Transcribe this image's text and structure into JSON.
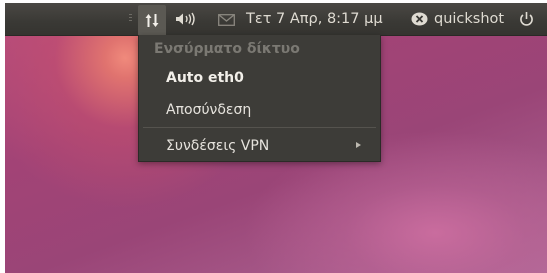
{
  "panel": {
    "clock": "Τετ  7 Απρ,  8:17 μμ",
    "username": "quickshot"
  },
  "network_menu": {
    "header": "Ενσύρματο δίκτυο",
    "items": [
      {
        "label": "Auto eth0",
        "bold": true
      },
      {
        "label": "Αποσύνδεση"
      },
      {
        "label": "Συνδέσεις VPN",
        "submenu": true
      }
    ]
  },
  "icons": {
    "network": "network-arrows-icon",
    "volume": "speaker-icon",
    "mail": "envelope-icon",
    "user": "user-status-icon",
    "power": "power-icon",
    "submenu": "submenu-arrow-icon"
  },
  "colors": {
    "panel_bg": "#3a3935",
    "menu_bg": "#3d3c38",
    "menu_text": "#e6e3dd",
    "menu_header_text": "#7b7973",
    "desktop_accent": "#a24376"
  }
}
